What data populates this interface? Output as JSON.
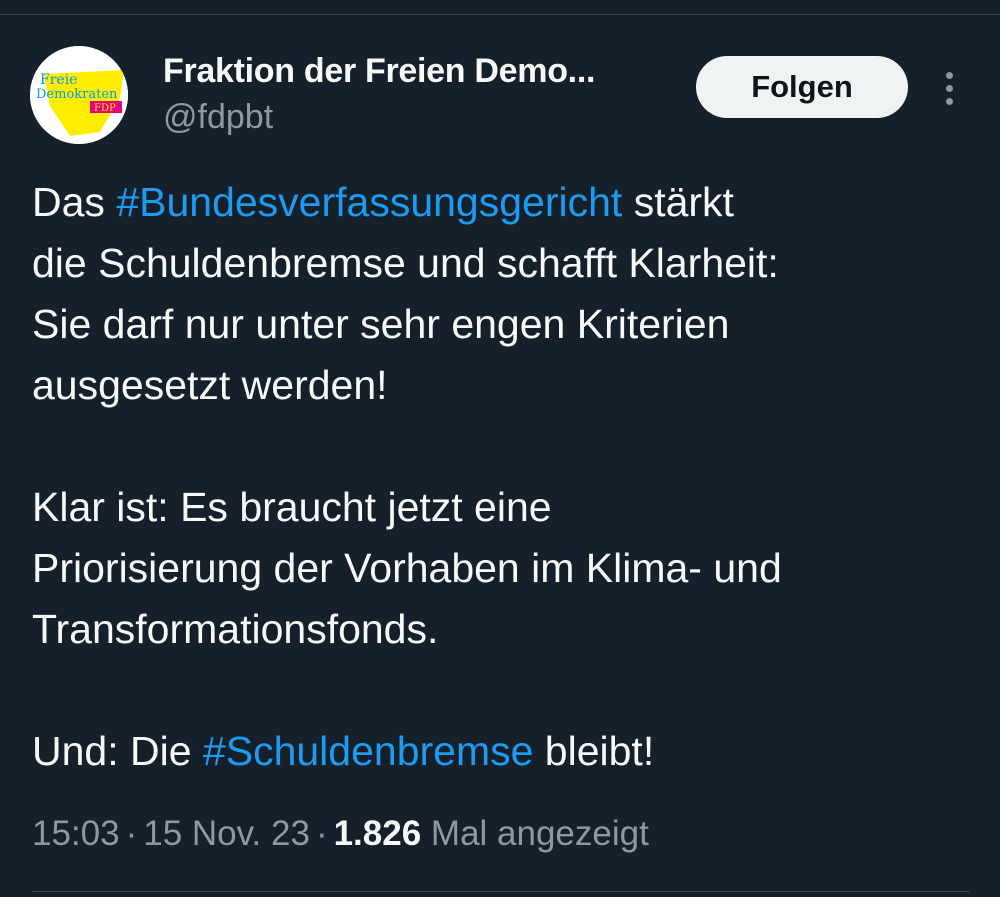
{
  "account": {
    "display_name": "Fraktion der Freien Demo...",
    "handle": "@fdpbt",
    "avatar_logo_text": [
      "Freie",
      "Demokraten",
      "FDP"
    ]
  },
  "actions": {
    "follow_label": "Folgen",
    "more_icon": "more-vertical-icon"
  },
  "tweet": {
    "para1": {
      "l1_pre": "Das ",
      "l1_tag": "#Bundesverfassungsgericht",
      "l1_post": " stärkt",
      "l2": "die Schuldenbremse und schafft Klarheit:",
      "l3": "Sie darf nur unter sehr engen Kriterien",
      "l4": "ausgesetzt werden!"
    },
    "para2": {
      "l1": "Klar ist: Es braucht jetzt eine",
      "l2": "Priorisierung der Vorhaben im Klima- und",
      "l3": "Transformationsfonds."
    },
    "para3": {
      "pre": "Und: Die ",
      "tag": "#Schuldenbremse",
      "post": " bleibt!"
    }
  },
  "meta": {
    "time": "15:03",
    "separator": "·",
    "date": "15 Nov. 23",
    "views_count": "1.826",
    "views_label": " Mal angezeigt"
  },
  "colors": {
    "background": "#15202b",
    "text": "#f7f9f9",
    "secondary": "#8b98a5",
    "link": "#1d9bf0",
    "fdp_yellow": "#ffed00",
    "fdp_blue": "#009ee3",
    "fdp_magenta": "#e5007d"
  }
}
